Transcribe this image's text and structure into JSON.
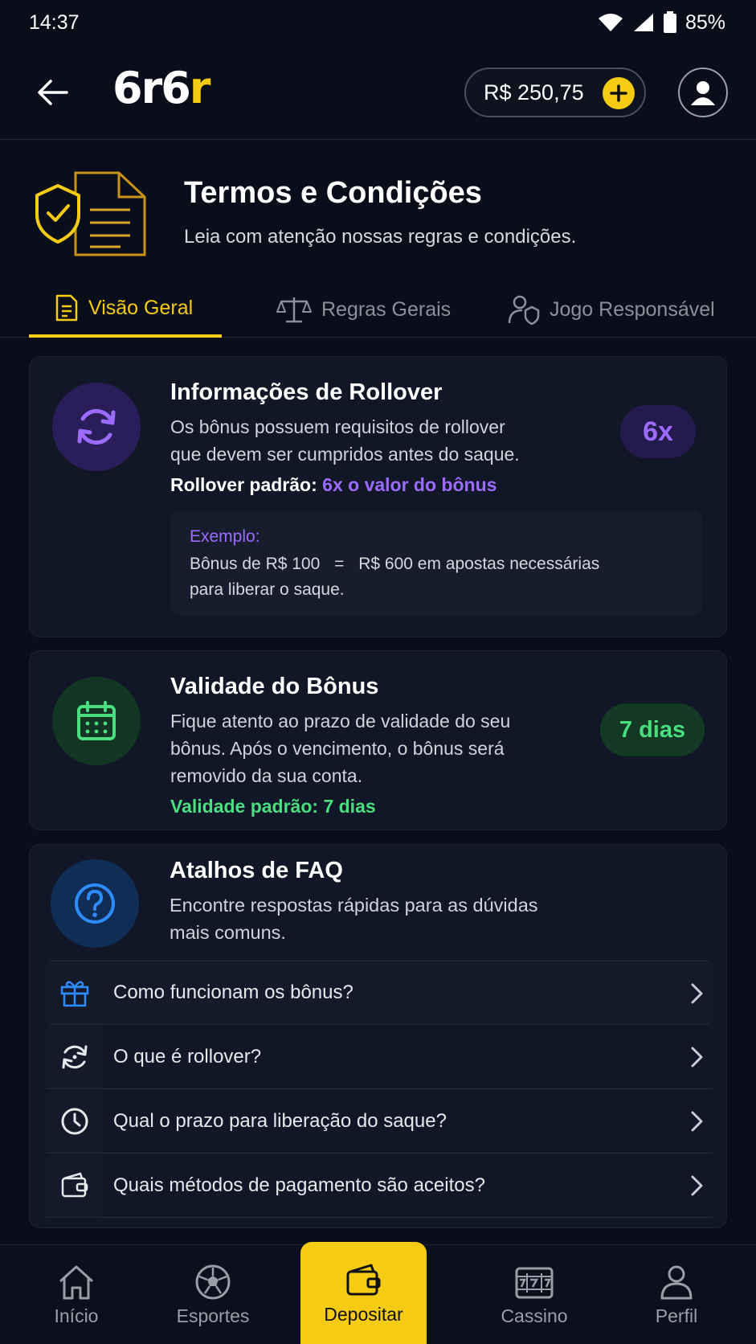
{
  "status_bar": {
    "time": "14:37",
    "battery": "85%"
  },
  "header": {
    "logo_part1": "6r",
    "logo_part2": "6",
    "logo_part3": "r",
    "balance": "R$ 250,75"
  },
  "hero": {
    "title": "Termos e Condições",
    "subtitle": "Leia com atenção nossas regras e condições."
  },
  "tabs": [
    {
      "label": "Visão Geral",
      "active": true
    },
    {
      "label": "Regras Gerais",
      "active": false
    },
    {
      "label": "Jogo Responsável",
      "active": false
    }
  ],
  "rollover": {
    "title": "Informações de Rollover",
    "text_line1": "Os bônus possuem requisitos de rollover",
    "text_line2": "que devem ser cumpridos antes do saque.",
    "default_label": "Rollover padrão:",
    "default_value": "6x o valor do bônus",
    "badge": "6x",
    "example_label": "Exemplo:",
    "example_line1_a": "Bônus de R$ 100",
    "example_line1_eq": "=",
    "example_line1_b": "R$ 600 em apostas necessárias",
    "example_line2": "para liberar o saque."
  },
  "validity": {
    "title": "Validade do Bônus",
    "text_line1": "Fique atento ao prazo de validade do seu",
    "text_line2": "bônus. Após o vencimento, o bônus será",
    "text_line3": "removido da sua conta.",
    "default_text": "Validade padrão: 7 dias",
    "badge": "7 dias"
  },
  "faq": {
    "title": "Atalhos de FAQ",
    "text_line1": "Encontre respostas rápidas para as dúvidas",
    "text_line2": "mais comuns.",
    "items": [
      {
        "label": "Como funcionam os bônus?",
        "icon": "gift-icon"
      },
      {
        "label": "O que é rollover?",
        "icon": "refresh-icon"
      },
      {
        "label": "Qual o prazo para liberação do saque?",
        "icon": "clock-icon"
      },
      {
        "label": "Quais métodos de pagamento são aceitos?",
        "icon": "wallet-icon"
      }
    ]
  },
  "bottom_nav": [
    {
      "label": "Início",
      "icon": "home-icon"
    },
    {
      "label": "Esportes",
      "icon": "soccer-ball-icon"
    },
    {
      "label": "Depositar",
      "icon": "wallet-icon",
      "active": true
    },
    {
      "label": "Cassino",
      "icon": "slot-machine-icon"
    },
    {
      "label": "Perfil",
      "icon": "user-icon"
    }
  ],
  "colors": {
    "background": "#0a0e1a",
    "brand_yellow": "#f5cc13",
    "purple_accent": "#9b6cff",
    "green_accent": "#4ade80",
    "blue_accent": "#2f8cff"
  }
}
